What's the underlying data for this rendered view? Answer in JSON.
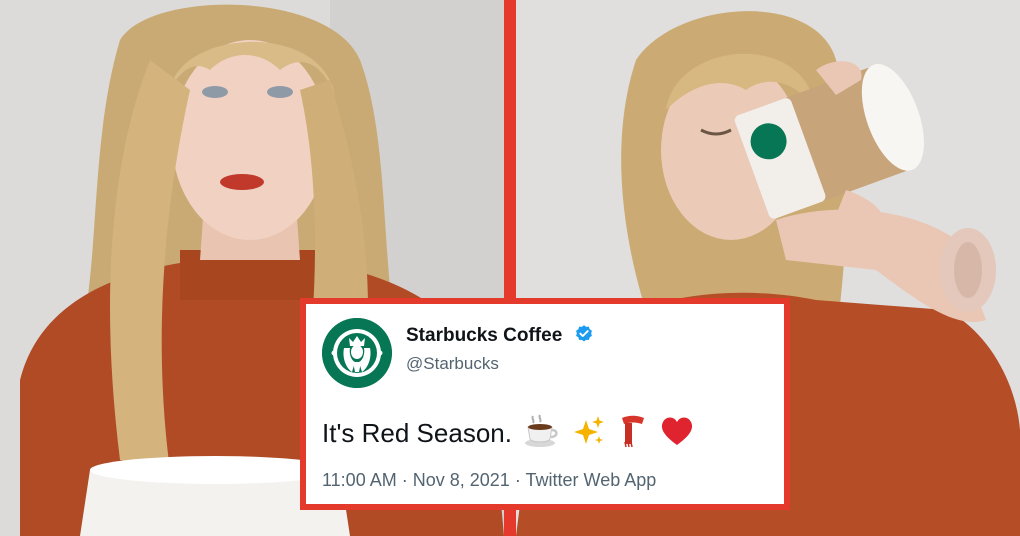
{
  "tweet": {
    "display_name": "Starbucks Coffee",
    "handle": "@Starbucks",
    "text": "It's Red Season.",
    "emojis": [
      "hot-beverage-emoji",
      "sparkles-emoji",
      "scarf-emoji",
      "red-heart-emoji"
    ],
    "time": "11:00 AM",
    "separator": "·",
    "date": "Nov 8, 2021",
    "source": "Twitter Web App",
    "verified": true
  },
  "colors": {
    "frame_red": "#e33a2c",
    "starbucks_green": "#067655",
    "verified_blue": "#1d9bf0",
    "sweater": "#b94f2a"
  }
}
